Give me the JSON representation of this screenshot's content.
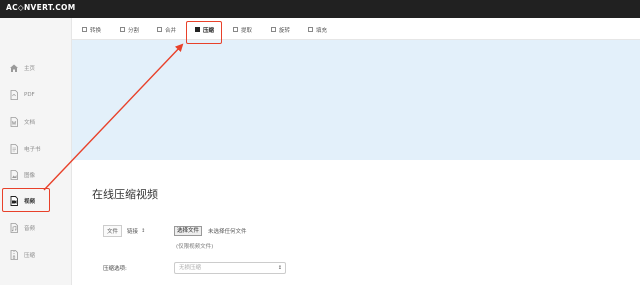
{
  "app": {
    "logo": "AC◇NVERT.COM"
  },
  "tabs": [
    {
      "label": "转换",
      "active": false
    },
    {
      "label": "分割",
      "active": false
    },
    {
      "label": "合并",
      "active": false
    },
    {
      "label": "压缩",
      "active": true
    },
    {
      "label": "提取",
      "active": false
    },
    {
      "label": "旋转",
      "active": false
    },
    {
      "label": "填充",
      "active": false
    }
  ],
  "sidebar": {
    "items": [
      {
        "label": "主页",
        "icon": "home-icon",
        "active": false
      },
      {
        "label": "PDF",
        "icon": "pdf-icon",
        "active": false
      },
      {
        "label": "文档",
        "icon": "document-icon",
        "active": false
      },
      {
        "label": "电子书",
        "icon": "ebook-icon",
        "active": false
      },
      {
        "label": "图像",
        "icon": "image-icon",
        "active": false
      },
      {
        "label": "视频",
        "icon": "video-icon",
        "active": true
      },
      {
        "label": "音频",
        "icon": "audio-icon",
        "active": false
      },
      {
        "label": "压缩",
        "icon": "archive-icon",
        "active": false
      }
    ]
  },
  "main": {
    "title": "在线压缩视频",
    "source": {
      "type": "文件",
      "mode": "链接",
      "spinner": "↕"
    },
    "file": {
      "button": "选择文件",
      "status": "未选择任何文件",
      "note": "(仅限视频文件)"
    },
    "option": {
      "label": "压缩选项:",
      "value": "无损压缩"
    }
  },
  "colors": {
    "topbar": "#212121",
    "banner": "#e3f0fa",
    "highlight": "#e8412a"
  }
}
